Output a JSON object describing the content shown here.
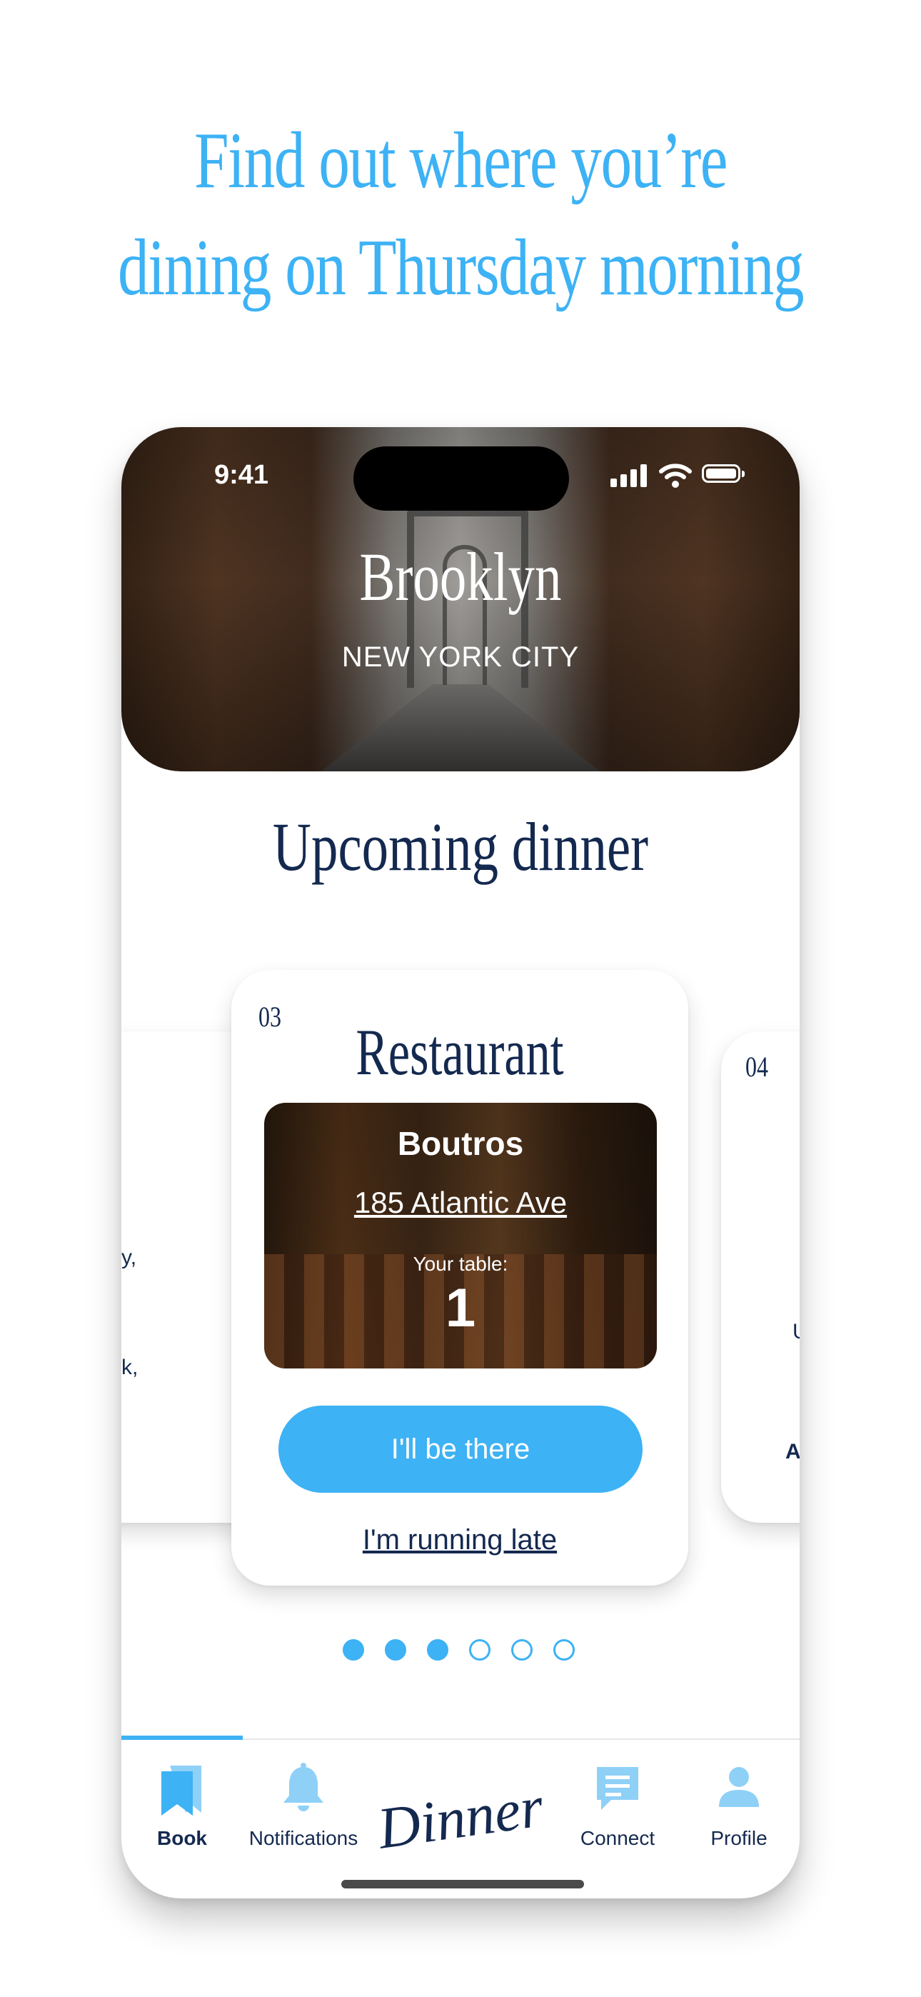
{
  "headline": {
    "line1": "Find out where you’re",
    "line2": "dining on Thursday morning"
  },
  "status_bar": {
    "time": "9:41"
  },
  "hero": {
    "title": "Brooklyn",
    "subtitle": "NEW YORK CITY"
  },
  "section": {
    "title": "Upcoming dinner"
  },
  "cards": {
    "main": {
      "number": "03",
      "title": "Restaurant",
      "venue_name": "Boutros",
      "venue_address": "185 Atlantic Ave",
      "table_label": "Your table:",
      "table_number": "1",
      "primary_button": "I'll be there",
      "secondary_link": "I'm running late"
    },
    "next": {
      "number": "04",
      "fragment1": "U",
      "fragment2": "A"
    },
    "previous": {
      "fragment1": ",",
      "fragment2": "y,",
      "fragment3": "k,"
    }
  },
  "pagination": {
    "total": 6,
    "active": 3
  },
  "tab_bar": {
    "tabs": [
      {
        "label": "Book",
        "icon": "bookmark-icon",
        "active": true
      },
      {
        "label": "Notifications",
        "icon": "bell-icon",
        "active": false
      },
      {
        "label": "Connect",
        "icon": "chat-icon",
        "active": false
      },
      {
        "label": "Profile",
        "icon": "person-icon",
        "active": false
      }
    ],
    "brand": "Dinner"
  },
  "colors": {
    "accent": "#3db2f5",
    "navy": "#14294f",
    "light_icon": "#8fd0f7"
  }
}
